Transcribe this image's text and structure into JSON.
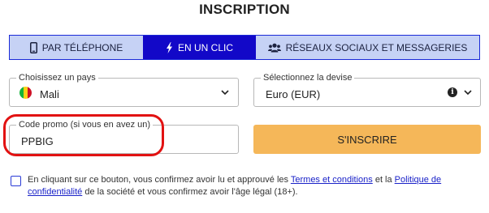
{
  "header": {
    "title": "INSCRIPTION"
  },
  "tabs": [
    {
      "label": "PAR TÉLÉPHONE",
      "icon": "phone-icon",
      "active": false
    },
    {
      "label": "EN UN CLIC",
      "icon": "lightning-icon",
      "active": true
    },
    {
      "label": "RÉSEAUX SOCIAUX ET MESSAGERIES",
      "icon": "users-icon",
      "active": false
    }
  ],
  "form": {
    "country": {
      "label": "Choisissez un pays",
      "value": "Mali",
      "flag_colors": [
        "#14b53a",
        "#fcd116",
        "#ce1126"
      ]
    },
    "currency": {
      "label": "Sélectionnez la devise",
      "value": "Euro (EUR)"
    },
    "promo": {
      "label": "Code promo (si vous en avez un)",
      "value": "PPBIG"
    },
    "submit_label": "S'INSCRIRE"
  },
  "terms": {
    "text_1": "En cliquant sur ce bouton, vous confirmez avoir lu et approuvé les ",
    "link_1": "Termes et conditions",
    "text_2": " et la ",
    "link_2": "Politique de confidentialité",
    "text_3": " de la société et vous confirmez avoir l'âge légal (18+)."
  },
  "colors": {
    "accent": "#1208c8",
    "tab_bg": "#c6d2f5",
    "submit_bg": "#f5b759",
    "highlight": "#e21212",
    "link": "#1a22c8"
  }
}
